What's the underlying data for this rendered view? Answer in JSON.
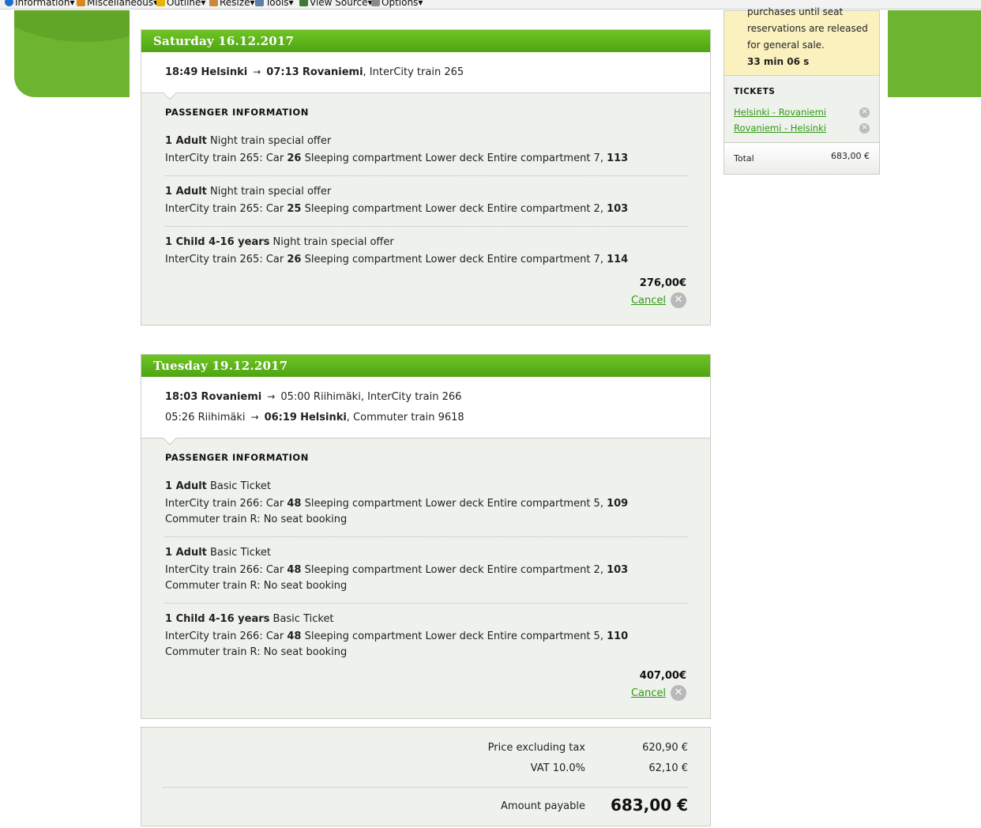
{
  "toolbar": {
    "items": [
      "Information",
      "Miscellaneous",
      "Outline",
      "Resize",
      "Tools",
      "View Source",
      "Options"
    ],
    "colors": [
      "#1f6fd1",
      "#d98a1a",
      "#e8b400",
      "#c98b3a",
      "#5a7fa8",
      "#3f7a3a",
      "#8a8a8a"
    ]
  },
  "journeys": [
    {
      "date": "Saturday 16.12.2017",
      "legs": [
        {
          "dep_time": "18:49",
          "dep_station": "Helsinki",
          "arrow": "→",
          "arr_time": "07:13",
          "arr_station": "Rovaniemi",
          "train": ", InterCity train 265"
        }
      ],
      "pi_title": "PASSENGER INFORMATION",
      "passengers": [
        {
          "type": "1 Adult",
          "offer": " Night train special offer",
          "seat_prefix": "InterCity train 265: Car ",
          "car": "26",
          "seat_desc": " Sleeping compartment Lower deck Entire compartment 7, ",
          "seat": "113"
        },
        {
          "type": "1 Adult",
          "offer": " Night train special offer",
          "seat_prefix": "InterCity train 265: Car ",
          "car": "25",
          "seat_desc": " Sleeping compartment Lower deck Entire compartment 2, ",
          "seat": "103"
        },
        {
          "type": "1 Child 4-16 years",
          "offer": " Night train special offer",
          "seat_prefix": "InterCity train 265: Car ",
          "car": "26",
          "seat_desc": " Sleeping compartment Lower deck Entire compartment 7, ",
          "seat": "114"
        }
      ],
      "price": "276,00€",
      "cancel": "Cancel"
    },
    {
      "date": "Tuesday 19.12.2017",
      "legs": [
        {
          "dep_time": "18:03",
          "dep_station": "Rovaniemi",
          "arrow": "→",
          "arr_time": "05:00",
          "arr_station": "Riihimäki",
          "train": ", InterCity train 266"
        },
        {
          "dep_time": "05:26",
          "dep_station": "Riihimäki",
          "arrow": "→",
          "arr_time": "06:19",
          "arr_station": "Helsinki",
          "train": ", Commuter train 9618"
        }
      ],
      "pi_title": "PASSENGER INFORMATION",
      "passengers": [
        {
          "type": "1 Adult",
          "offer": " Basic Ticket",
          "seat_prefix": "InterCity train 266: Car ",
          "car": "48",
          "seat_desc": " Sleeping compartment Lower deck Entire compartment 5, ",
          "seat": "109",
          "extra": "Commuter train R: No seat booking"
        },
        {
          "type": "1 Adult",
          "offer": " Basic Ticket",
          "seat_prefix": "InterCity train 266: Car ",
          "car": "48",
          "seat_desc": " Sleeping compartment Lower deck Entire compartment 2, ",
          "seat": "103",
          "extra": "Commuter train R: No seat booking"
        },
        {
          "type": "1 Child 4-16 years",
          "offer": " Basic Ticket",
          "seat_prefix": "InterCity train 266: Car ",
          "car": "48",
          "seat_desc": " Sleeping compartment Lower deck Entire compartment 5, ",
          "seat": "110",
          "extra": "Commuter train R: No seat booking"
        }
      ],
      "price": "407,00€",
      "cancel": "Cancel"
    }
  ],
  "summary": {
    "price_ex_tax_label": "Price excluding tax",
    "price_ex_tax": "620,90 €",
    "vat_label": "VAT 10.0%",
    "vat": "62,10 €",
    "total_label": "Amount payable",
    "total": "683,00 €"
  },
  "sidebar": {
    "timer_lines": [
      "purchases until seat",
      "reservations are released",
      "for general sale."
    ],
    "timer_value": "33 min 06 s",
    "tickets_title": "TICKETS",
    "tickets": [
      "Helsinki - Rovaniemi",
      "Rovaniemi - Helsinki"
    ],
    "total_label": "Total",
    "total_value": "683,00 €"
  },
  "theme": {
    "accent_green": "#6db430",
    "link_green": "#2f9a12",
    "notice_yellow": "#fbf1be"
  }
}
